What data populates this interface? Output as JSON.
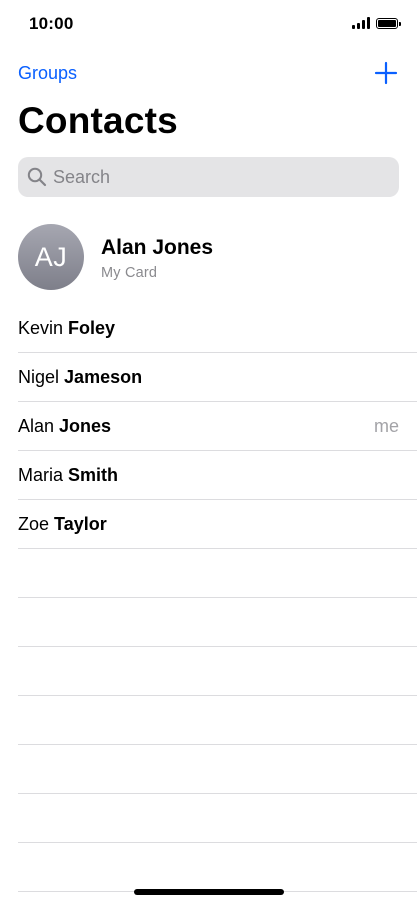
{
  "status_bar": {
    "time": "10:00"
  },
  "nav": {
    "groups_label": "Groups",
    "add_icon": "plus-icon"
  },
  "title": "Contacts",
  "search": {
    "placeholder": "Search",
    "value": "",
    "icon": "search-icon"
  },
  "my_card": {
    "initials": "AJ",
    "name": "Alan Jones",
    "subtitle": "My Card"
  },
  "contacts": [
    {
      "first": "Kevin",
      "last": "Foley",
      "badge": ""
    },
    {
      "first": "Nigel",
      "last": "Jameson",
      "badge": ""
    },
    {
      "first": "Alan",
      "last": "Jones",
      "badge": "me"
    },
    {
      "first": "Maria",
      "last": "Smith",
      "badge": ""
    },
    {
      "first": "Zoe",
      "last": "Taylor",
      "badge": ""
    }
  ],
  "colors": {
    "accent": "#0a60ff",
    "search_bg": "#e4e4e6",
    "separator": "#dcdcdf",
    "secondary_text": "#8a8a8e"
  }
}
